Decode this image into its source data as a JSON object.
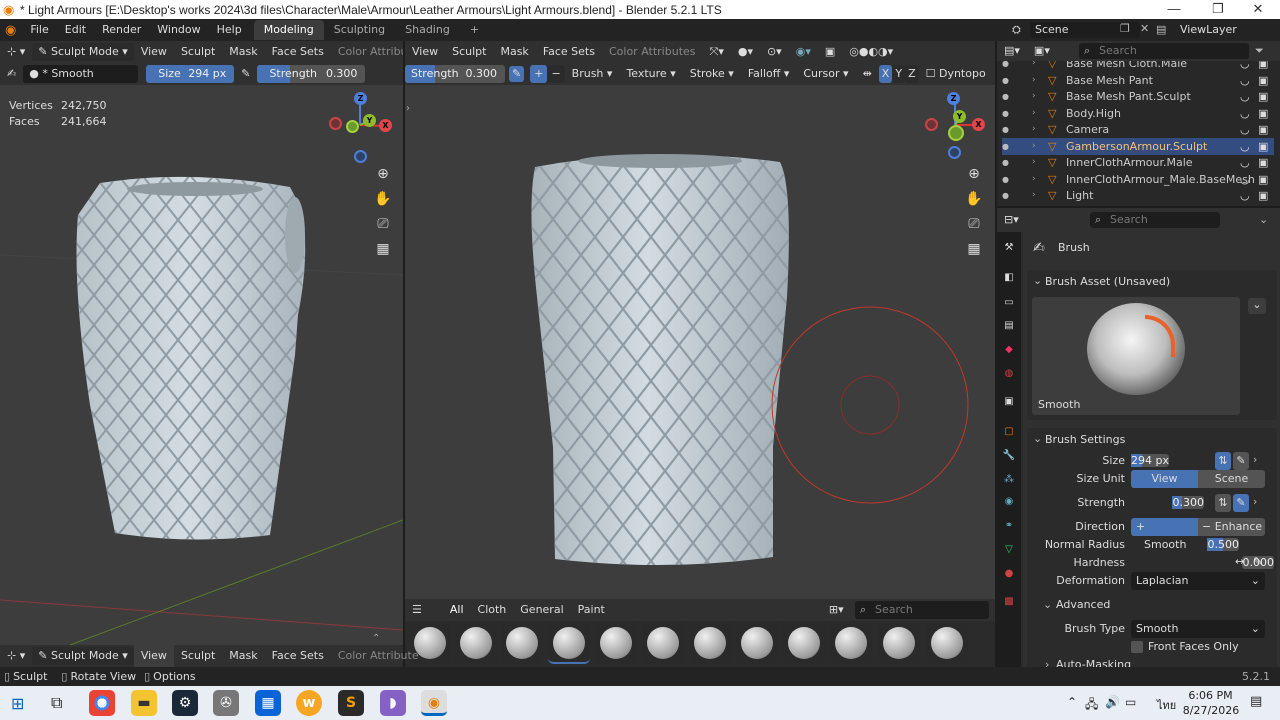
{
  "window": {
    "title": "* Light Armours [E:\\Desktop's works 2024\\3d files\\Character\\Male\\Armour\\Leather Armours\\Light Armours.blend] - Blender 5.2.1 LTS",
    "minimize": "—",
    "maximize": "❐",
    "close": "✕"
  },
  "topmenu": [
    "File",
    "Edit",
    "Render",
    "Window",
    "Help"
  ],
  "workspaces": [
    "Modeling",
    "Sculpting",
    "Shading"
  ],
  "workspace_add": "+",
  "scene": {
    "name": "Scene",
    "view_layer": "ViewLayer"
  },
  "left_header": {
    "mode": "Sculpt Mode",
    "menus": [
      "View",
      "Sculpt",
      "Mask",
      "Face Sets"
    ],
    "color_attr": "Color Attribute"
  },
  "tool_settings": {
    "brush_name": "* Smooth",
    "size_label": "Size",
    "size_value": "294 px",
    "strength_label": "Strength",
    "strength_value": "0.300",
    "strength_label2": "Strength",
    "strength_value2": "0.300",
    "menus": [
      "Brush",
      "Texture",
      "Stroke",
      "Falloff",
      "Cursor"
    ],
    "axes": [
      "X",
      "Y",
      "Z"
    ],
    "dyntopo": "Dyntopo"
  },
  "right_header": {
    "menus": [
      "View",
      "Sculpt",
      "Mask",
      "Face Sets"
    ],
    "color_attr": "Color Attributes"
  },
  "stats": {
    "vertices_label": "Vertices",
    "vertices": "242,750",
    "faces_label": "Faces",
    "faces": "241,664"
  },
  "gizmo": {
    "x": "X",
    "y": "Y",
    "z": "Z"
  },
  "asset_shelf": {
    "tabs": [
      "All",
      "Cloth",
      "General",
      "Paint"
    ],
    "search_placeholder": "Search"
  },
  "bottom_header": {
    "mode": "Sculpt Mode",
    "menus": [
      "View",
      "Sculpt",
      "Mask",
      "Face Sets"
    ],
    "color_attr": "Color Attribute"
  },
  "status": {
    "left1": "Sculpt",
    "left2": "Rotate View",
    "left3": "Options",
    "version": "5.2.1"
  },
  "outliner": {
    "search_placeholder": "Search",
    "rows": [
      {
        "name": "Base Mesh Cloth.Male",
        "active": false
      },
      {
        "name": "Base Mesh Pant",
        "active": false
      },
      {
        "name": "Base Mesh Pant.Sculpt",
        "active": false
      },
      {
        "name": "Body.High",
        "active": false
      },
      {
        "name": "Camera",
        "active": false
      },
      {
        "name": "GambersonArmour.Sculpt",
        "active": true
      },
      {
        "name": "InnerClothArmour.Male",
        "active": false
      },
      {
        "name": "InnerClothArmour_Male.BaseMesh",
        "active": false
      },
      {
        "name": "Light",
        "active": false
      }
    ]
  },
  "properties": {
    "search_placeholder": "Search",
    "brush_title": "Brush",
    "asset_panel": "Brush Asset (Unsaved)",
    "asset_name": "Smooth",
    "settings_panel": "Brush Settings",
    "size_label": "Size",
    "size_value": "294 px",
    "size_unit_label": "Size Unit",
    "size_unit_view": "View",
    "size_unit_scene": "Scene",
    "strength_label": "Strength",
    "strength_value": "0.300",
    "direction_label": "Direction",
    "direction_smooth": "Smooth",
    "direction_enhance": "Enhance ...",
    "normal_radius_label": "Normal Radius",
    "normal_radius_value": "0.500",
    "hardness_label": "Hardness",
    "hardness_value": "0.000",
    "deformation_label": "Deformation",
    "deformation_value": "Laplacian",
    "advanced_panel": "Advanced",
    "brush_type_label": "Brush Type",
    "brush_type_value": "Smooth",
    "front_faces_label": "Front Faces Only",
    "auto_masking_panel": "Auto-Masking"
  },
  "taskbar": {
    "time": "6:06 PM",
    "date": "8/27/2026",
    "lang": "ไทย"
  },
  "colors": {
    "accent": "#4772b3",
    "active_row": "#334d80",
    "vp_bg": "#3d3d3d",
    "header_bg": "#303030"
  }
}
